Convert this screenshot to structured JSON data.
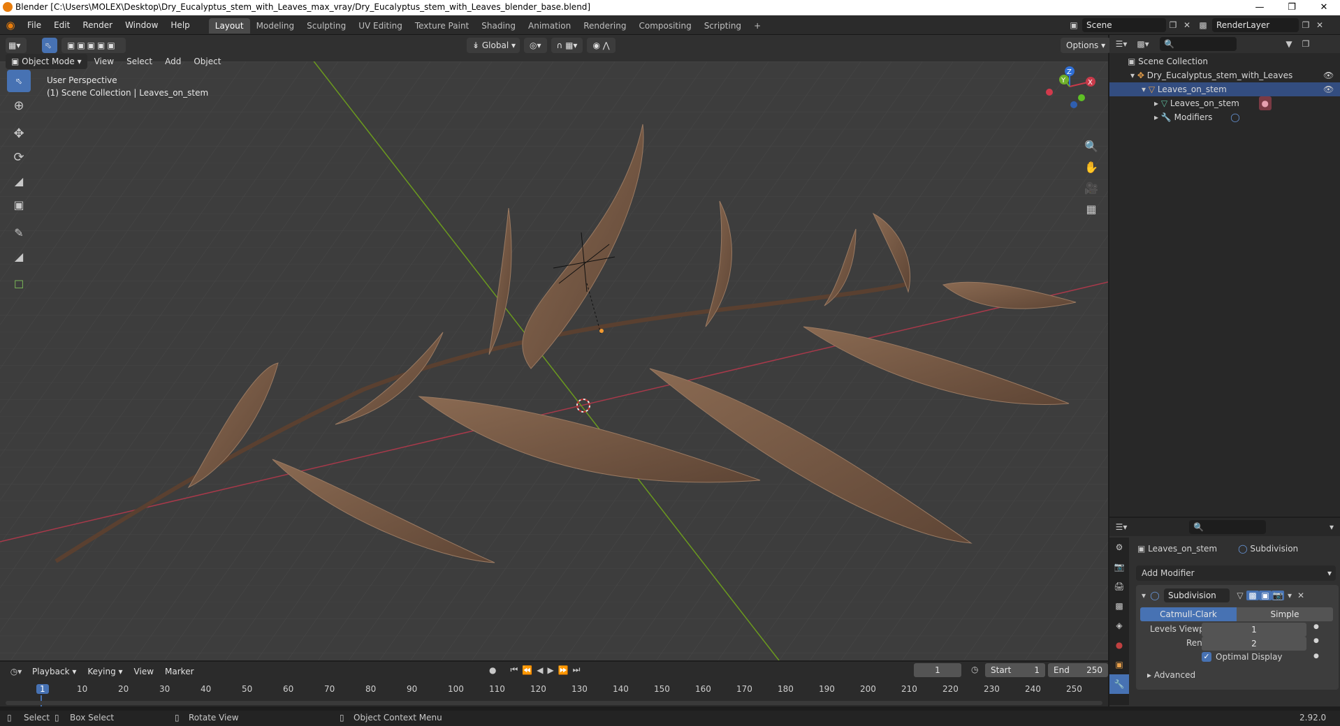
{
  "window": {
    "title": "Blender [C:\\Users\\MOLEX\\Desktop\\Dry_Eucalyptus_stem_with_Leaves_max_vray/Dry_Eucalyptus_stem_with_Leaves_blender_base.blend]",
    "minimize": "—",
    "restore": "❐",
    "close": "✕"
  },
  "menu": [
    "File",
    "Edit",
    "Render",
    "Window",
    "Help"
  ],
  "workspaces": [
    "Layout",
    "Modeling",
    "Sculpting",
    "UV Editing",
    "Texture Paint",
    "Shading",
    "Animation",
    "Rendering",
    "Compositing",
    "Scripting",
    "+"
  ],
  "scene": {
    "name": "Scene",
    "render_layer": "RenderLayer"
  },
  "header": {
    "mode": "Object Mode",
    "menus": [
      "View",
      "Select",
      "Add",
      "Object"
    ],
    "orientation": "Global",
    "options": "Options"
  },
  "viewport": {
    "perspective": "User Perspective",
    "collection": "(1) Scene Collection | Leaves_on_stem"
  },
  "gizmo": {
    "x": "X",
    "y": "Y",
    "z": "Z"
  },
  "outliner": {
    "root": "Scene Collection",
    "items": [
      {
        "label": "Dry_Eucalyptus_stem_with_Leaves"
      },
      {
        "label": "Leaves_on_stem"
      },
      {
        "label": "Leaves_on_stem"
      },
      {
        "label": "Modifiers"
      }
    ]
  },
  "properties": {
    "object": "Leaves_on_stem",
    "modifier_tab": "Subdivision",
    "add_modifier": "Add Modifier",
    "modifier_name": "Subdivision",
    "algo": [
      "Catmull-Clark",
      "Simple"
    ],
    "levels_viewport_label": "Levels Viewport",
    "levels_viewport": "1",
    "render_label": "Render",
    "render": "2",
    "optimal_display": "Optimal Display",
    "advanced": "Advanced"
  },
  "timeline": {
    "menus": [
      "Playback",
      "Keying",
      "View",
      "Marker"
    ],
    "current_frame": "1",
    "start_label": "Start",
    "start": "1",
    "end_label": "End",
    "end": "250",
    "ticks": [
      "1",
      "10",
      "20",
      "30",
      "40",
      "50",
      "60",
      "70",
      "80",
      "90",
      "100",
      "110",
      "120",
      "130",
      "140",
      "150",
      "160",
      "170",
      "180",
      "190",
      "200",
      "210",
      "220",
      "230",
      "240",
      "250"
    ]
  },
  "status": {
    "select": "Select",
    "box_select": "Box Select",
    "rotate": "Rotate View",
    "context": "Object Context Menu",
    "version": "2.92.0"
  },
  "colors": {
    "accent": "#4772b3",
    "selected_row": "#334d80",
    "x_axis": "#b03a48",
    "y_axis": "#6b9a1e",
    "leaf": "#7a5a44"
  }
}
